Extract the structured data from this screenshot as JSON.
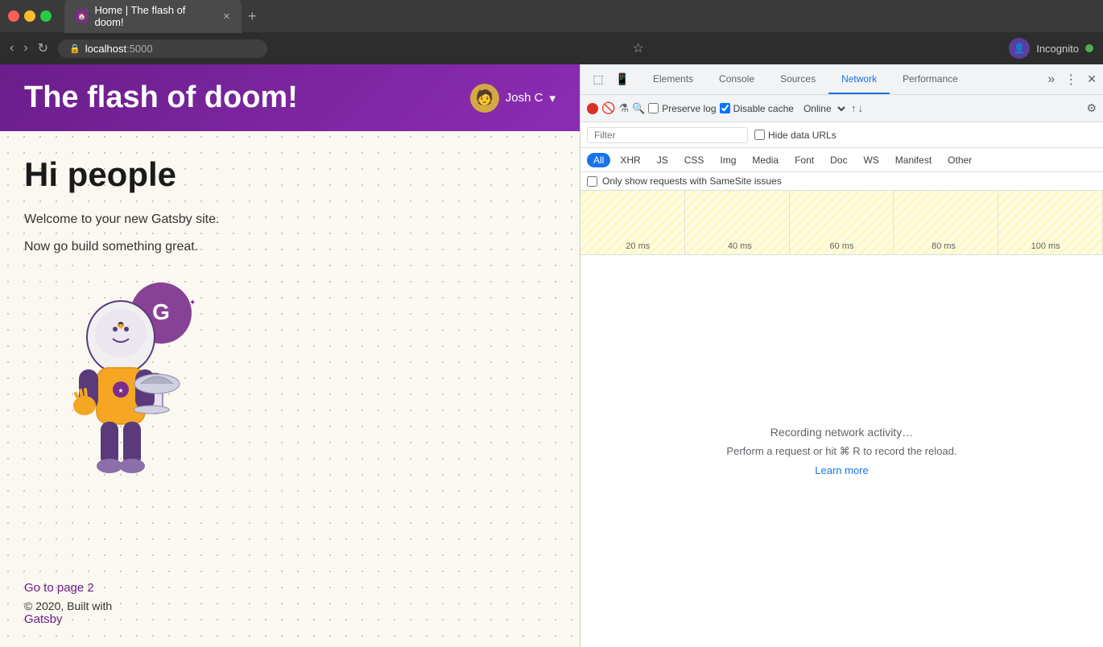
{
  "browser": {
    "tab_title": "Home | The flash of doom!",
    "url_protocol": "localhost",
    "url_port": ":5000",
    "new_tab_label": "+",
    "profile_name": "Incognito"
  },
  "webpage": {
    "site_title": "The flash of doom!",
    "user_name": "Josh C",
    "hero_heading": "Hi people",
    "paragraph1": "Welcome to your new Gatsby site.",
    "paragraph2": "Now go build something great.",
    "link_text": "Go to page 2",
    "footer_text": "© 2020, Built with",
    "gatsby_link": "Gatsby"
  },
  "devtools": {
    "tabs": [
      {
        "id": "elements",
        "label": "Elements"
      },
      {
        "id": "console",
        "label": "Console"
      },
      {
        "id": "sources",
        "label": "Sources"
      },
      {
        "id": "network",
        "label": "Network"
      },
      {
        "id": "performance",
        "label": "Performance"
      }
    ],
    "active_tab": "network",
    "toolbar": {
      "preserve_log": "Preserve log",
      "disable_cache": "Disable cache",
      "throttle": "Online"
    },
    "filter": {
      "placeholder": "Filter",
      "hide_data_urls": "Hide data URLs"
    },
    "type_filters": [
      "All",
      "XHR",
      "JS",
      "CSS",
      "Img",
      "Media",
      "Font",
      "Doc",
      "WS",
      "Manifest",
      "Other"
    ],
    "active_type": "All",
    "samesite_label": "Only show requests with SameSite issues",
    "timeline": {
      "labels": [
        "20 ms",
        "40 ms",
        "60 ms",
        "80 ms",
        "100 ms"
      ]
    },
    "empty_state": {
      "recording": "Recording network activity…",
      "hint": "Perform a request or hit ⌘ R to record the reload.",
      "learn_more": "Learn more"
    }
  }
}
